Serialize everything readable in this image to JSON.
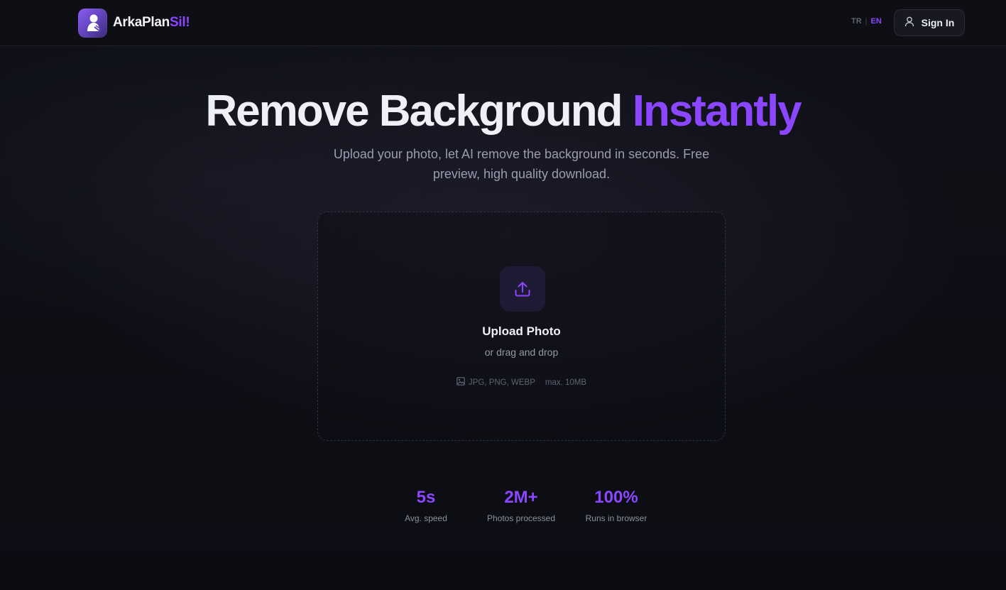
{
  "header": {
    "brand_part1": "ArkaPlan",
    "brand_part2": "Sil!",
    "lang_tr": "TR",
    "lang_sep": "|",
    "lang_en": "EN",
    "signin_label": "Sign In"
  },
  "hero": {
    "title_part1": "Remove Background",
    "title_part2": "Instantly",
    "subtitle": "Upload your photo, let AI remove the background in seconds. Free preview, high quality download."
  },
  "upload": {
    "title": "Upload Photo",
    "subtitle": "or drag and drop",
    "formats": "JPG, PNG, WEBP",
    "max_size": "max. 10MB"
  },
  "stats": [
    {
      "value": "5s",
      "label": "Avg. speed"
    },
    {
      "value": "2M+",
      "label": "Photos processed"
    },
    {
      "value": "100%",
      "label": "Runs in browser"
    }
  ],
  "colors": {
    "accent": "#8b46ff",
    "background": "#0d0e14"
  },
  "icons": {
    "logo": "person-silhouette-icon",
    "signin": "user-icon",
    "upload": "upload-icon",
    "formats": "image-icon"
  }
}
